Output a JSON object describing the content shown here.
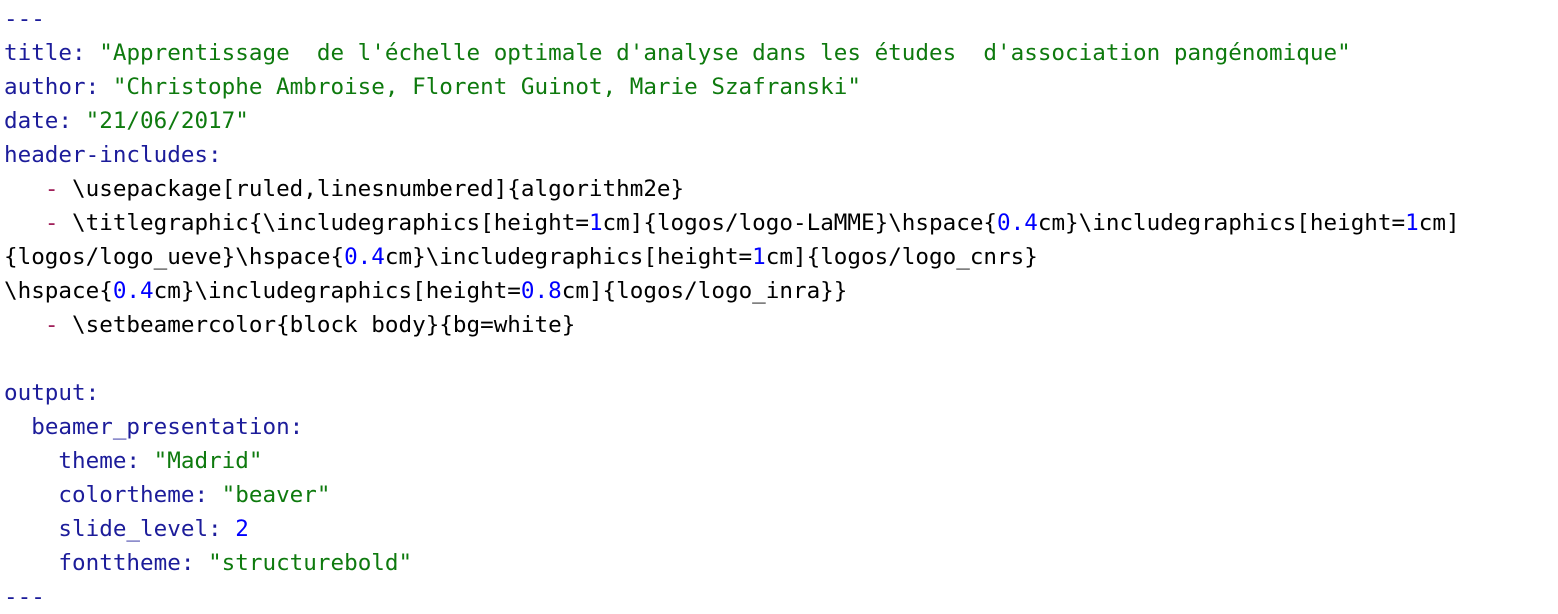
{
  "colors": {
    "key": "#1c1c9a",
    "string": "#0e7a0e",
    "number": "#0000ff",
    "list_dash": "#a0205a",
    "plain": "#000000",
    "background": "#ffffff"
  },
  "lines": [
    [
      {
        "t": "delim",
        "v": "---"
      }
    ],
    [
      {
        "t": "key",
        "v": "title:"
      },
      {
        "t": "plain",
        "v": " "
      },
      {
        "t": "str",
        "v": "\"Apprentissage  de l'échelle optimale d'analyse dans les études  d'association pangénomique\""
      }
    ],
    [
      {
        "t": "key",
        "v": "author:"
      },
      {
        "t": "plain",
        "v": " "
      },
      {
        "t": "str",
        "v": "\"Christophe Ambroise, Florent Guinot, Marie Szafranski\""
      }
    ],
    [
      {
        "t": "key",
        "v": "date:"
      },
      {
        "t": "plain",
        "v": " "
      },
      {
        "t": "str",
        "v": "\"21/06/2017\""
      }
    ],
    [
      {
        "t": "key",
        "v": "header-includes:"
      }
    ],
    [
      {
        "t": "plain",
        "v": "   "
      },
      {
        "t": "dash",
        "v": "-"
      },
      {
        "t": "plain",
        "v": " \\usepackage[ruled,linesnumbered]{algorithm2e}"
      }
    ],
    [
      {
        "t": "plain",
        "v": "   "
      },
      {
        "t": "dash",
        "v": "-"
      },
      {
        "t": "plain",
        "v": " \\titlegraphic{\\includegraphics[height="
      },
      {
        "t": "num",
        "v": "1"
      },
      {
        "t": "plain",
        "v": "cm]{logos/logo-LaMME}\\hspace{"
      },
      {
        "t": "num",
        "v": "0.4"
      },
      {
        "t": "plain",
        "v": "cm}\\includegraphics[height="
      },
      {
        "t": "num",
        "v": "1"
      },
      {
        "t": "plain",
        "v": "cm]"
      }
    ],
    [
      {
        "t": "plain",
        "v": "{logos/logo_ueve}\\hspace{"
      },
      {
        "t": "num",
        "v": "0.4"
      },
      {
        "t": "plain",
        "v": "cm}\\includegraphics[height="
      },
      {
        "t": "num",
        "v": "1"
      },
      {
        "t": "plain",
        "v": "cm]{logos/logo_cnrs}"
      }
    ],
    [
      {
        "t": "plain",
        "v": "\\hspace{"
      },
      {
        "t": "num",
        "v": "0.4"
      },
      {
        "t": "plain",
        "v": "cm}\\includegraphics[height="
      },
      {
        "t": "num",
        "v": "0.8"
      },
      {
        "t": "plain",
        "v": "cm]{logos/logo_inra}}"
      }
    ],
    [
      {
        "t": "plain",
        "v": "   "
      },
      {
        "t": "dash",
        "v": "-"
      },
      {
        "t": "plain",
        "v": " \\setbeamercolor{block body}{bg=white}"
      }
    ],
    [],
    [
      {
        "t": "key",
        "v": "output:"
      }
    ],
    [
      {
        "t": "plain",
        "v": "  "
      },
      {
        "t": "key",
        "v": "beamer_presentation:"
      }
    ],
    [
      {
        "t": "plain",
        "v": "    "
      },
      {
        "t": "key",
        "v": "theme:"
      },
      {
        "t": "plain",
        "v": " "
      },
      {
        "t": "str",
        "v": "\"Madrid\""
      }
    ],
    [
      {
        "t": "plain",
        "v": "    "
      },
      {
        "t": "key",
        "v": "colortheme:"
      },
      {
        "t": "plain",
        "v": " "
      },
      {
        "t": "str",
        "v": "\"beaver\""
      }
    ],
    [
      {
        "t": "plain",
        "v": "    "
      },
      {
        "t": "key",
        "v": "slide_level:"
      },
      {
        "t": "plain",
        "v": " "
      },
      {
        "t": "num",
        "v": "2"
      }
    ],
    [
      {
        "t": "plain",
        "v": "    "
      },
      {
        "t": "key",
        "v": "fonttheme:"
      },
      {
        "t": "plain",
        "v": " "
      },
      {
        "t": "str",
        "v": "\"structurebold\""
      }
    ],
    [
      {
        "t": "delim",
        "v": "---"
      }
    ]
  ]
}
